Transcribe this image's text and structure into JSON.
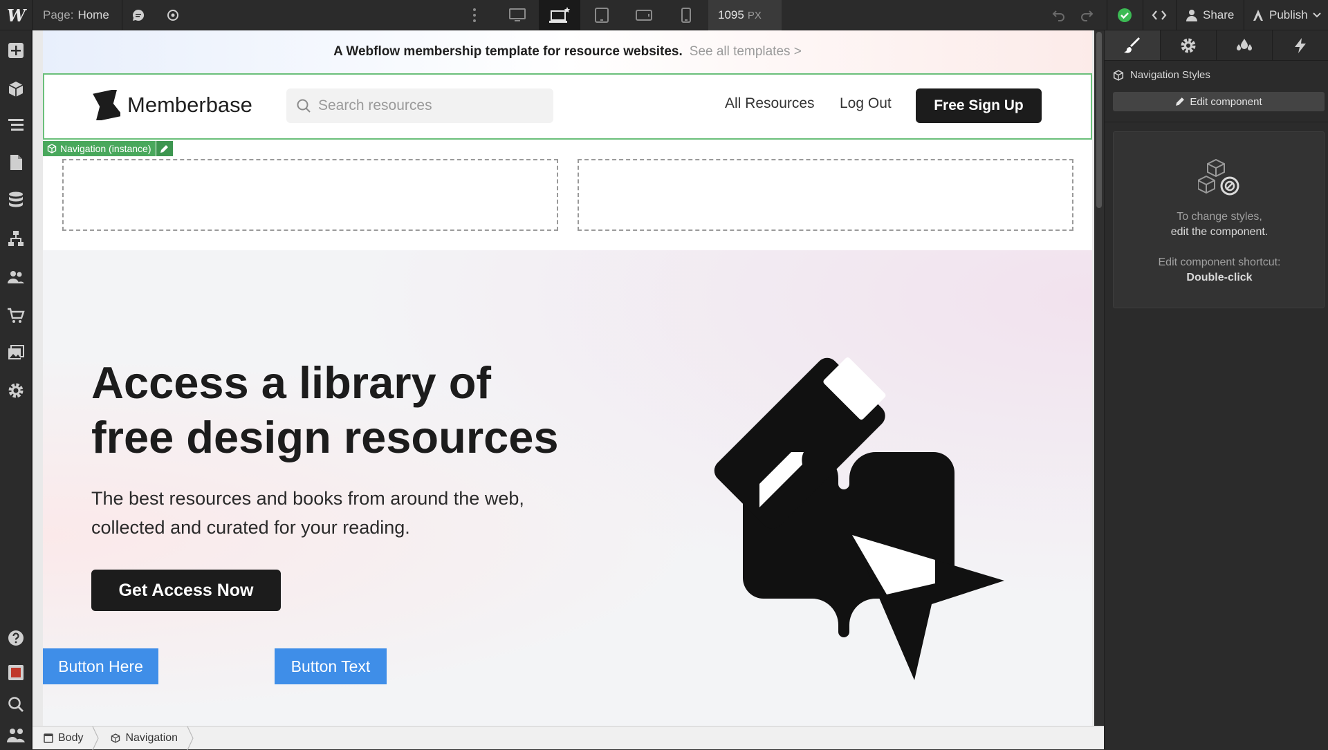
{
  "topbar": {
    "logo": "W",
    "page_prefix": "Page:",
    "page_name": "Home",
    "width_value": "1095",
    "width_unit": "PX",
    "share_label": "Share",
    "publish_label": "Publish",
    "icons": [
      "comment-icon",
      "preview-eye-icon",
      "more-vertical-icon",
      "desktop-icon",
      "laptop-star-icon",
      "tablet-icon",
      "mobile-landscape-icon",
      "mobile-portrait-icon",
      "undo-icon",
      "redo-icon",
      "status-check-icon",
      "code-icon",
      "user-icon",
      "publish-icon"
    ],
    "status_color": "#3cba54"
  },
  "left_sidebar": {
    "icons": [
      "add-panel-icon",
      "components-icon",
      "navigator-icon",
      "pages-icon",
      "cms-icon",
      "logic-icon",
      "users-icon",
      "ecommerce-icon",
      "assets-icon",
      "settings-icon",
      "help-icon",
      "tutorial-icon",
      "search-icon",
      "people-icon"
    ]
  },
  "site": {
    "banner_text": "A Webflow membership template for resource websites.",
    "banner_link": "See all templates >",
    "brand_name": "Memberbase",
    "search_placeholder": "Search resources",
    "nav_links": [
      "All Resources",
      "Log Out"
    ],
    "signup_label": "Free Sign Up",
    "nav_tag": "Navigation (instance)",
    "hero_title_line1": "Access a library of",
    "hero_title_line2": "free design resources",
    "hero_sub_line1": "The best resources and books from around the web,",
    "hero_sub_line2": "collected and curated for your reading.",
    "hero_cta": "Get Access Now",
    "blue_button_1": "Button Here",
    "blue_button_2": "Button Text",
    "accent_blue": "#3f8ee8",
    "selection_green": "#49a85c"
  },
  "breadcrumbs": [
    "Body",
    "Navigation"
  ],
  "right_panel": {
    "tabs": [
      "style-brush-icon",
      "settings-gear-icon",
      "interactions-drops-icon",
      "lightning-icon"
    ],
    "section_title": "Navigation Styles",
    "edit_button": "Edit component",
    "info_line1": "To change styles,",
    "info_line2": "edit the component.",
    "shortcut_label": "Edit component shortcut:",
    "shortcut_value": "Double-click"
  }
}
